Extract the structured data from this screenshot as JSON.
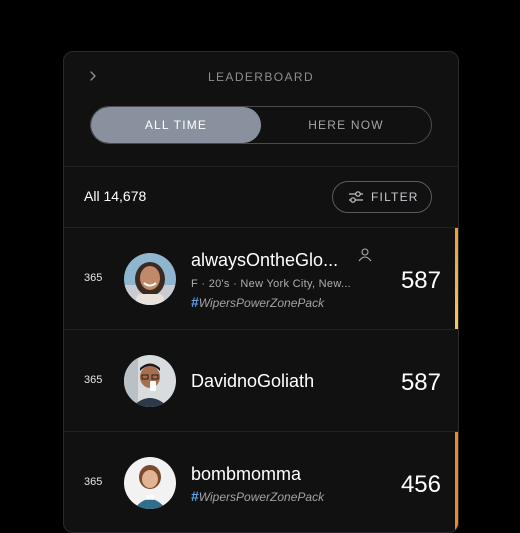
{
  "header": {
    "title": "LEADERBOARD",
    "back_icon": "chevron-right-icon"
  },
  "tabs": [
    {
      "label": "ALL TIME",
      "active": true
    },
    {
      "label": "HERE NOW",
      "active": false
    }
  ],
  "summary": {
    "count_label": "All 14,678",
    "filter_label": "FILTER",
    "filter_icon": "sliders-icon"
  },
  "rows": [
    {
      "rank": "365",
      "name": "alwaysOntheGlo...",
      "meta": "F · 20's · New York City, New...",
      "hashtag": "WipersPowerZonePack",
      "score": "587",
      "follow_icon": "person-icon",
      "accent": "#e8b53a"
    },
    {
      "rank": "365",
      "name": "DavidnoGoliath",
      "score": "587"
    },
    {
      "rank": "365",
      "name": "bombmomma",
      "hashtag": "WipersPowerZonePack",
      "score": "456",
      "accent": "#f08a28"
    }
  ],
  "colors": {
    "background": "#000000",
    "panel": "#111112",
    "tab_active": "#8a919e",
    "hashtag_symbol": "#5b9fe6"
  }
}
